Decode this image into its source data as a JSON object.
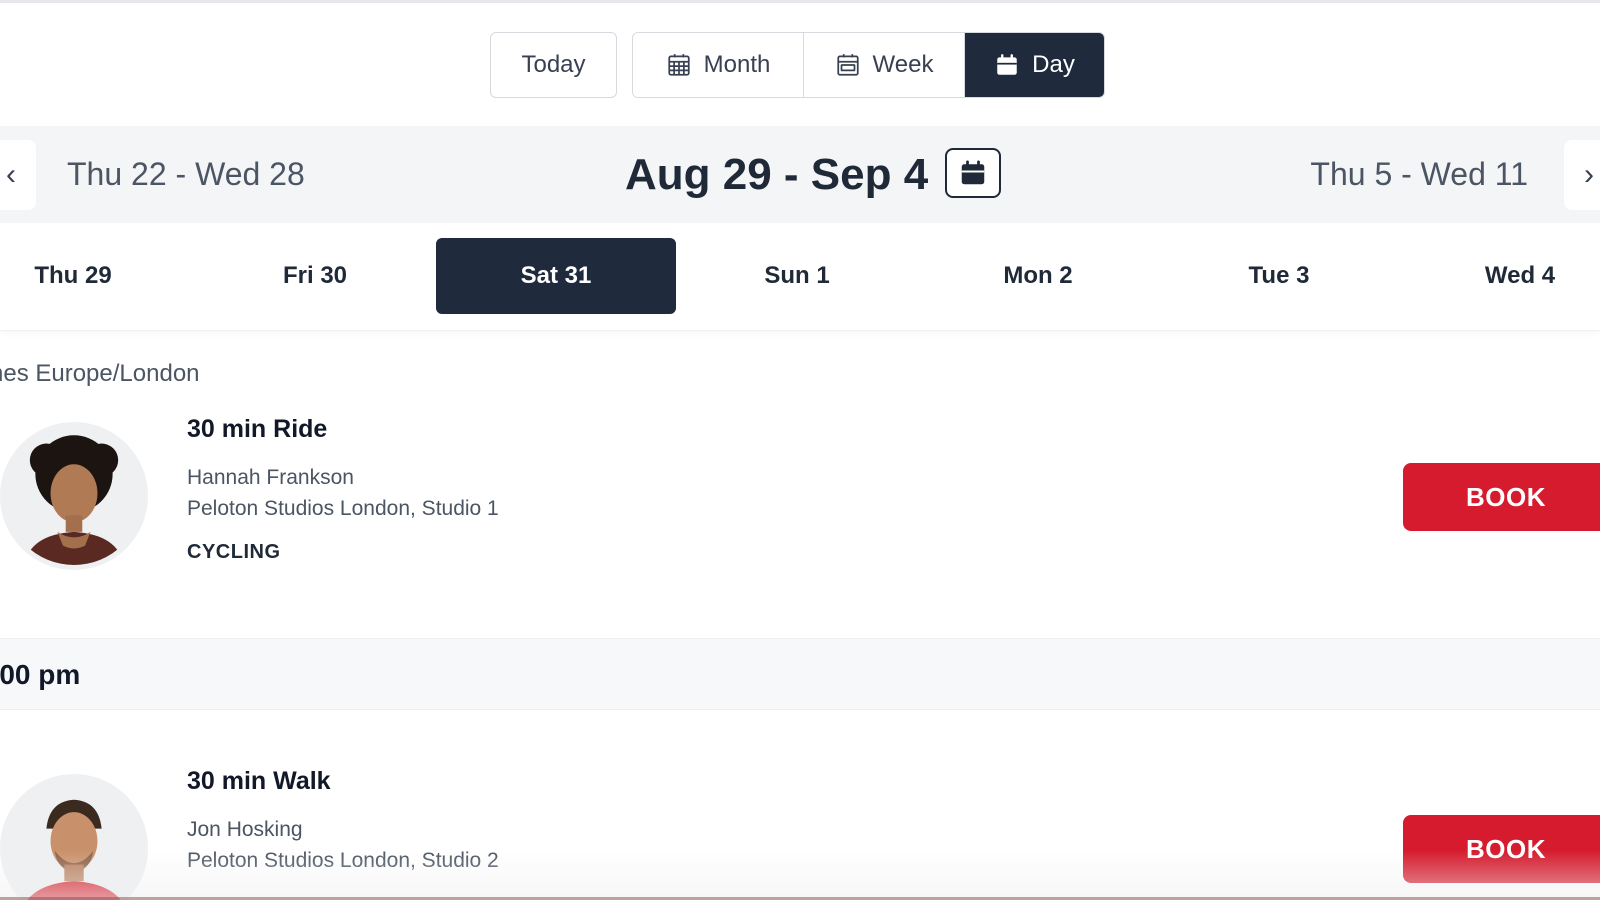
{
  "toolbar": {
    "today_label": "Today",
    "month_label": "Month",
    "week_label": "Week",
    "day_label": "Day",
    "active_view": "Day"
  },
  "week_nav": {
    "prev_range": "Thu 22 - Wed 28",
    "current_range": "Aug 29 - Sep 4",
    "next_range": "Thu 5 - Wed 11",
    "prev_icon": "chevron-left-icon",
    "next_icon": "chevron-right-icon",
    "picker_icon": "calendar-icon"
  },
  "days": [
    {
      "label": "Thu 29"
    },
    {
      "label": "Fri 30"
    },
    {
      "label": "Sat 31"
    },
    {
      "label": "Sun 1"
    },
    {
      "label": "Mon 2"
    },
    {
      "label": "Tue 3"
    },
    {
      "label": "Wed 4"
    }
  ],
  "active_day": "Sat 31",
  "timezone_label": "nes Europe/London",
  "classes": [
    {
      "title": "30 min Ride",
      "instructor": "Hannah Frankson",
      "location": "Peloton Studios London, Studio 1",
      "discipline": "CYCLING",
      "button": "BOOK"
    },
    {
      "title": "30 min Walk",
      "instructor": "Jon Hosking",
      "location": "Peloton Studios London, Studio 2",
      "button": "BOOK"
    }
  ],
  "time_slot": ":00 pm",
  "colors": {
    "primary_dark": "#1f2a3d",
    "book_red": "#d51b2d",
    "nav_bg": "#f4f5f7"
  }
}
